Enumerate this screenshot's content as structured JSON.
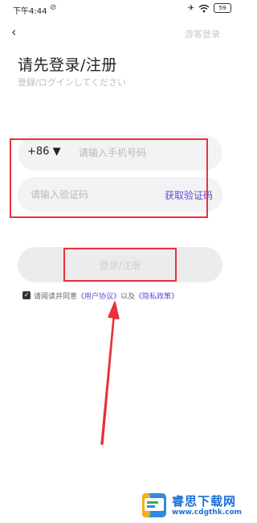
{
  "status_bar": {
    "time": "下午4:44",
    "alarm_icon": "alarm-off-icon",
    "airplane_icon": "airplane-icon",
    "wifi_icon": "wifi-icon",
    "battery_level": "59"
  },
  "nav": {
    "back_icon": "chevron-left-icon",
    "back_glyph": "‹",
    "guest_login_label": "游客登录"
  },
  "header": {
    "title": "请先登录/注册",
    "subtitle": "登録/ログインしてください"
  },
  "form": {
    "country_code": "+86 ▼",
    "phone_placeholder": "请输入手机号码",
    "code_placeholder": "请输入验证码",
    "get_code_label": "获取验证码",
    "submit_label": "登录/注册"
  },
  "agreement": {
    "checked": true,
    "checkmark": "✓",
    "prefix": "请阅读并同意",
    "user_agreement": "《用户协议》",
    "conjunction": "以及",
    "privacy_policy": "《隐私政策》"
  },
  "annotation": {
    "highlight_color": "#e8323c"
  },
  "watermark": {
    "name": "睿思下载网",
    "url": "www.cdgthk.com"
  },
  "colors": {
    "accent": "#5a4fd0",
    "field_bg": "#f3f3f5",
    "watermark_blue": "#1d6fd6"
  }
}
